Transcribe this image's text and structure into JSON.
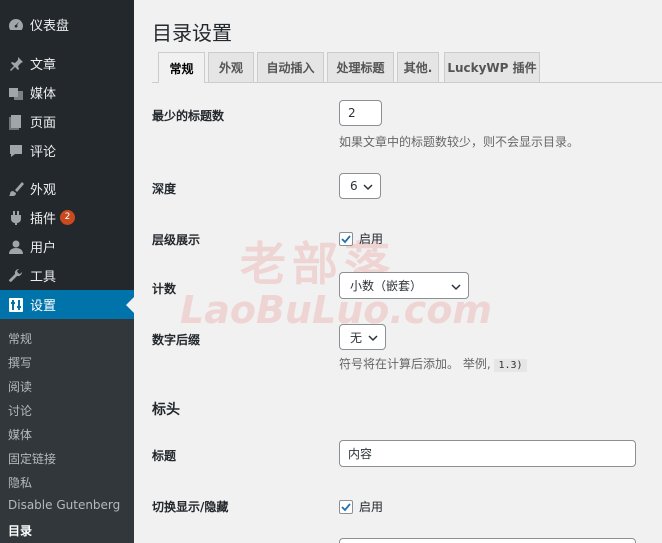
{
  "sidebar": {
    "items": [
      {
        "label": "仪表盘",
        "icon": "dashboard-icon"
      },
      {
        "label": "文章",
        "icon": "pin-icon"
      },
      {
        "label": "媒体",
        "icon": "media-icon"
      },
      {
        "label": "页面",
        "icon": "page-icon"
      },
      {
        "label": "评论",
        "icon": "comment-icon"
      },
      {
        "label": "外观",
        "icon": "brush-icon"
      },
      {
        "label": "插件",
        "icon": "plugin-icon",
        "badge": "2"
      },
      {
        "label": "用户",
        "icon": "user-icon"
      },
      {
        "label": "工具",
        "icon": "wrench-icon"
      },
      {
        "label": "设置",
        "icon": "settings-icon",
        "active": true
      }
    ],
    "submenu": [
      "常规",
      "撰写",
      "阅读",
      "讨论",
      "媒体",
      "固定链接",
      "隐私",
      "Disable Gutenberg",
      "目录"
    ],
    "submenu_current": "目录"
  },
  "page": {
    "title": "目录设置",
    "tabs": [
      "常规",
      "外观",
      "自动插入",
      "处理标题",
      "其他.",
      "LuckyWP 插件"
    ],
    "active_tab": "常规"
  },
  "settings": {
    "min_headings": {
      "label": "最少的标题数",
      "value": "2",
      "desc": "如果文章中的标题数较少，则不会显示目录。"
    },
    "depth": {
      "label": "深度",
      "value": "6"
    },
    "hierarchical": {
      "label": "层级展示",
      "checkbox_label": "启用",
      "checked": true
    },
    "numeration": {
      "label": "计数",
      "value": "小数（嵌套）"
    },
    "numeration_suffix": {
      "label": "数字后缀",
      "value": "无",
      "desc": "符号将在计算后添加。 举例,",
      "example": "1.3)"
    },
    "header_section": "标头",
    "title": {
      "label": "标题",
      "value": "内容"
    },
    "toggle": {
      "label": "切换显示/隐藏",
      "checkbox_label": "启用",
      "checked": true
    }
  },
  "watermark": {
    "cn": "老部落",
    "en": "LaoBuLuo.com"
  },
  "colors": {
    "sidebar_bg": "#23282d",
    "submenu_bg": "#32373c",
    "accent": "#0073aa",
    "badge": "#ca4a1f",
    "page_bg": "#f1f1f1"
  }
}
